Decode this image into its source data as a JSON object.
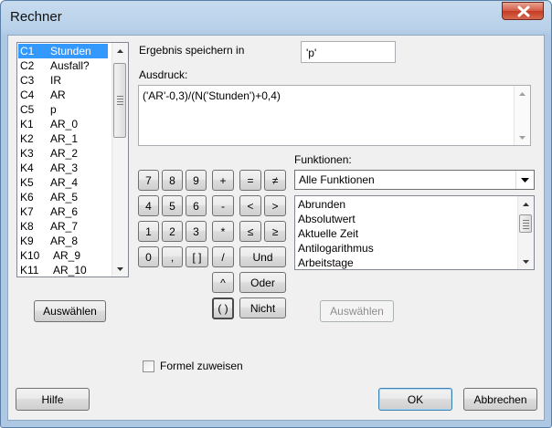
{
  "window": {
    "title": "Rechner"
  },
  "variables": {
    "items": [
      {
        "id": "C1",
        "name": "Stunden",
        "selected": true
      },
      {
        "id": "C2",
        "name": "Ausfall?"
      },
      {
        "id": "C3",
        "name": "IR"
      },
      {
        "id": "C4",
        "name": "AR"
      },
      {
        "id": "C5",
        "name": "p"
      },
      {
        "id": "K1",
        "name": "AR_0"
      },
      {
        "id": "K2",
        "name": "AR_1"
      },
      {
        "id": "K3",
        "name": "AR_2"
      },
      {
        "id": "K4",
        "name": "AR_3"
      },
      {
        "id": "K5",
        "name": "AR_4"
      },
      {
        "id": "K6",
        "name": "AR_5"
      },
      {
        "id": "K7",
        "name": "AR_6"
      },
      {
        "id": "K8",
        "name": "AR_7"
      },
      {
        "id": "K9",
        "name": "AR_8"
      },
      {
        "id": "K10",
        "name": "AR_9"
      },
      {
        "id": "K11",
        "name": "AR_10"
      }
    ],
    "select_button": "Auswählen"
  },
  "store_result": {
    "label": "Ergebnis speichern in",
    "value": "'p'"
  },
  "expression": {
    "label": "Ausdruck:",
    "value": "('AR'-0,3)/(N('Stunden')+0,4)"
  },
  "keypad": {
    "k7": "7",
    "k8": "8",
    "k9": "9",
    "plus": "+",
    "eq": "=",
    "neq": "≠",
    "k4": "4",
    "k5": "5",
    "k6": "6",
    "minus": "-",
    "lt": "<",
    "gt": ">",
    "k1": "1",
    "k2": "2",
    "k3": "3",
    "mul": "*",
    "le": "≤",
    "ge": "≥",
    "k0": "0",
    "comma": ",",
    "brackets": "[ ]",
    "div": "/",
    "and": "Und",
    "pow": "^",
    "or": "Oder",
    "parens": "( )",
    "not": "Nicht"
  },
  "functions": {
    "label": "Funktionen:",
    "category": "Alle Funktionen",
    "items": [
      "Abrunden",
      "Absolutwert",
      "Aktuelle Zeit",
      "Antilogarithmus",
      "Arbeitstage"
    ],
    "select_button": "Auswählen"
  },
  "assign_formula": {
    "label": "Formel zuweisen",
    "checked": false
  },
  "footer": {
    "help": "Hilfe",
    "ok": "OK",
    "cancel": "Abbrechen"
  }
}
